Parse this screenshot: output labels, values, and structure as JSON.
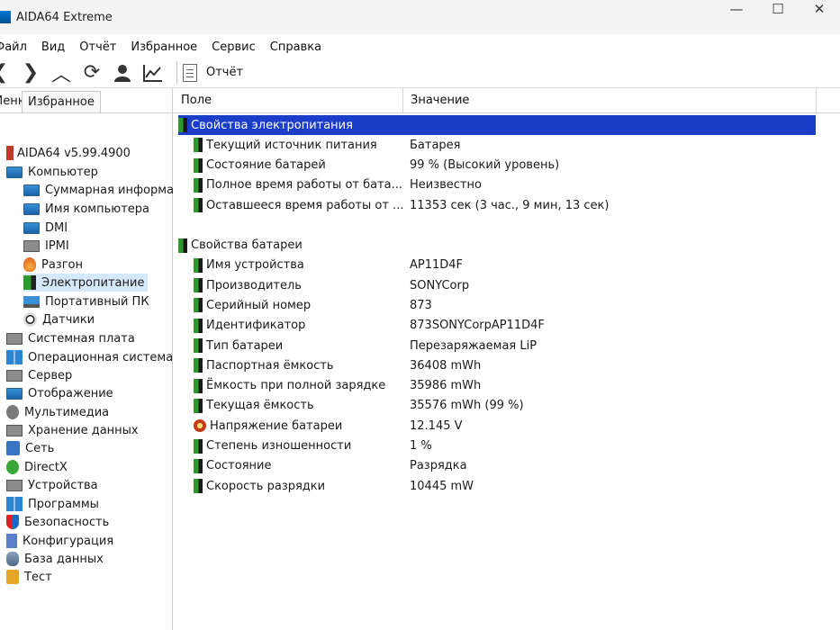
{
  "window": {
    "title": "AIDA64 Extreme",
    "min": "—",
    "max": "☐",
    "close": "✕"
  },
  "menu": [
    "Файл",
    "Вид",
    "Отчёт",
    "Избранное",
    "Сервис",
    "Справка"
  ],
  "toolbar": {
    "report_label": "Отчёт"
  },
  "left_tabs": {
    "menu": "Меню",
    "favorites": "Избранное"
  },
  "tree": [
    {
      "label": "AIDA64 v5.99.4900",
      "icon": "aida-icon",
      "cls": "ico-aida",
      "indent": 0
    },
    {
      "label": "Компьютер",
      "icon": "computer-icon",
      "cls": "ico-mon",
      "indent": 0
    },
    {
      "label": "Суммарная информация",
      "icon": "monitor-icon",
      "cls": "ico-mon",
      "indent": 1
    },
    {
      "label": "Имя компьютера",
      "icon": "monitor-icon",
      "cls": "ico-mon",
      "indent": 1
    },
    {
      "label": "DMI",
      "icon": "monitor-icon",
      "cls": "ico-mon",
      "indent": 1
    },
    {
      "label": "IPMI",
      "icon": "server-icon",
      "cls": "ico-gray",
      "indent": 1
    },
    {
      "label": "Разгон",
      "icon": "flame-icon",
      "cls": "ico-fire",
      "indent": 1
    },
    {
      "label": "Электропитание",
      "icon": "battery-icon",
      "cls": "ico-bat",
      "indent": 1,
      "selected": true
    },
    {
      "label": "Портативный ПК",
      "icon": "laptop-icon",
      "cls": "ico-laptop",
      "indent": 1
    },
    {
      "label": "Датчики",
      "icon": "gauge-icon",
      "cls": "ico-gauge",
      "indent": 1
    },
    {
      "label": "Системная плата",
      "icon": "motherboard-icon",
      "cls": "ico-gray",
      "indent": 0
    },
    {
      "label": "Операционная система",
      "icon": "windows-icon",
      "cls": "ico-win",
      "indent": 0
    },
    {
      "label": "Сервер",
      "icon": "server-icon",
      "cls": "ico-gray",
      "indent": 0
    },
    {
      "label": "Отображение",
      "icon": "display-icon",
      "cls": "ico-mon",
      "indent": 0
    },
    {
      "label": "Мультимедиа",
      "icon": "multimedia-icon",
      "cls": "ico-music",
      "indent": 0
    },
    {
      "label": "Хранение данных",
      "icon": "storage-icon",
      "cls": "ico-gray",
      "indent": 0
    },
    {
      "label": "Сеть",
      "icon": "network-icon",
      "cls": "ico-blue",
      "indent": 0
    },
    {
      "label": "DirectX",
      "icon": "directx-icon",
      "cls": "ico-green",
      "indent": 0
    },
    {
      "label": "Устройства",
      "icon": "devices-icon",
      "cls": "ico-gray",
      "indent": 0
    },
    {
      "label": "Программы",
      "icon": "programs-icon",
      "cls": "ico-win",
      "indent": 0
    },
    {
      "label": "Безопасность",
      "icon": "shield-icon",
      "cls": "ico-shield",
      "indent": 0
    },
    {
      "label": "Конфигурация",
      "icon": "config-icon",
      "cls": "ico-doc",
      "indent": 0
    },
    {
      "label": "База данных",
      "icon": "database-icon",
      "cls": "ico-db",
      "indent": 0
    },
    {
      "label": "Тест",
      "icon": "benchmark-icon",
      "cls": "ico-orange",
      "indent": 0
    }
  ],
  "columns": {
    "field": "Поле",
    "value": "Значение"
  },
  "sections": [
    {
      "title": "Свойства электропитания",
      "selected": true,
      "rows": [
        {
          "field": "Текущий источник питания",
          "value": "Батарея"
        },
        {
          "field": "Состояние батарей",
          "value": "99 % (Высокий уровень)"
        },
        {
          "field": "Полное время работы от бата...",
          "value": "Неизвестно"
        },
        {
          "field": "Оставшееся время работы от ...",
          "value": "11353 сек (3 час., 9 мин, 13 сек)"
        }
      ]
    },
    {
      "title": "Свойства батареи",
      "selected": false,
      "rows": [
        {
          "field": "Имя устройства",
          "value": "AP11D4F"
        },
        {
          "field": "Производитель",
          "value": "SONYCorp"
        },
        {
          "field": "Серийный номер",
          "value": "873"
        },
        {
          "field": "Идентификатор",
          "value": "873SONYCorpAP11D4F"
        },
        {
          "field": "Тип батареи",
          "value": "Перезаряжаемая LiP"
        },
        {
          "field": "Паспортная ёмкость",
          "value": "36408 mWh"
        },
        {
          "field": "Ёмкость при полной зарядке",
          "value": "35986 mWh"
        },
        {
          "field": "Текущая ёмкость",
          "value": "35576 mWh  (99 %)"
        },
        {
          "field": "Напряжение батареи",
          "value": "12.145 V",
          "icon": "voltage-icon"
        },
        {
          "field": "Степень изношенности",
          "value": "1 %"
        },
        {
          "field": "Состояние",
          "value": "Разрядка"
        },
        {
          "field": "Скорость разрядки",
          "value": "10445 mW"
        }
      ]
    }
  ]
}
